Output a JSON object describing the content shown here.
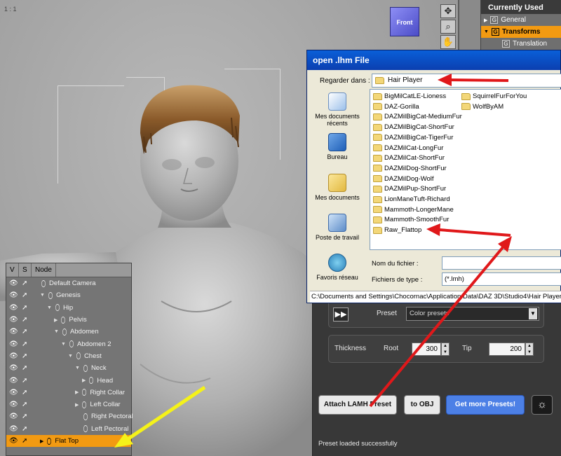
{
  "viewport": {
    "label": "1 : 1",
    "camera_cube_label": "Front"
  },
  "parameters": {
    "title": "Currently Used",
    "items": [
      {
        "label": "General",
        "glyph": "G",
        "highlight": false
      },
      {
        "label": "Transforms",
        "glyph": "G",
        "highlight": true
      },
      {
        "label": "Translation",
        "glyph": "G",
        "highlight": false
      }
    ]
  },
  "scene": {
    "headers": [
      "V",
      "S",
      "Node"
    ],
    "rows": [
      {
        "label": "Default Camera",
        "selected": false
      },
      {
        "label": "Genesis",
        "selected": false
      },
      {
        "label": "Hip",
        "selected": false
      },
      {
        "label": "Pelvis",
        "selected": false
      },
      {
        "label": "Abdomen",
        "selected": false
      },
      {
        "label": "Abdomen 2",
        "selected": false
      },
      {
        "label": "Chest",
        "selected": false
      },
      {
        "label": "Neck",
        "selected": false
      },
      {
        "label": "Head",
        "selected": false
      },
      {
        "label": "Right Collar",
        "selected": false
      },
      {
        "label": "Left Collar",
        "selected": false
      },
      {
        "label": "Right Pectoral",
        "selected": false
      },
      {
        "label": "Left Pectoral",
        "selected": false
      },
      {
        "label": "Flat Top",
        "selected": true
      }
    ]
  },
  "dialog": {
    "title": "open .lhm File",
    "look_in_label": "Regarder dans :",
    "look_in_value": "Hair Player",
    "places": [
      "Mes documents récents",
      "Bureau",
      "Mes documents",
      "Poste de travail",
      "Favoris réseau"
    ],
    "folders_col1": [
      "BigMilCatLE-Lioness",
      "DAZ-Gorilla",
      "DAZMilBigCat-MediumFur",
      "DAZMilBigCat-ShortFur",
      "DAZMilBigCat-TigerFur",
      "DAZMilCat-LongFur",
      "DAZMilCat-ShortFur",
      "DAZMilDog-ShortFur",
      "DAZMilDog-Wolf",
      "DAZMilPup-ShortFur",
      "LionManeTuft-Richard",
      "Mammoth-LongerMane",
      "Mammoth-SmoothFur",
      "Raw_Flattop"
    ],
    "folders_col2": [
      "SquirrelFurForYou",
      "WolfByAM"
    ],
    "filename_label": "Nom du fichier :",
    "filename_value": "",
    "filetype_label": "Fichiers de type :",
    "filetype_value": "(*.lmh)",
    "path": "C:\\Documents and Settings\\Chocornac\\Application Data\\DAZ 3D\\Studio4\\Hair Player"
  },
  "hair_panel": {
    "preset_label": "Preset",
    "preset_value": "Color presets",
    "thickness_label": "Thickness",
    "root_label": "Root",
    "root_value": "300",
    "tip_label": "Tip",
    "tip_value": "200",
    "attach_button": "Attach LAMH Preset",
    "obj_button": "to OBJ",
    "more_button": "Get more Presets!",
    "status": "Preset loaded successfully"
  },
  "colors": {
    "selection_orange": "#f29a12",
    "arrow_red": "#e0181a",
    "arrow_yellow": "#f5f219",
    "xp_title_blue": "#0a5fd8",
    "button_blue": "#4c80e6"
  }
}
